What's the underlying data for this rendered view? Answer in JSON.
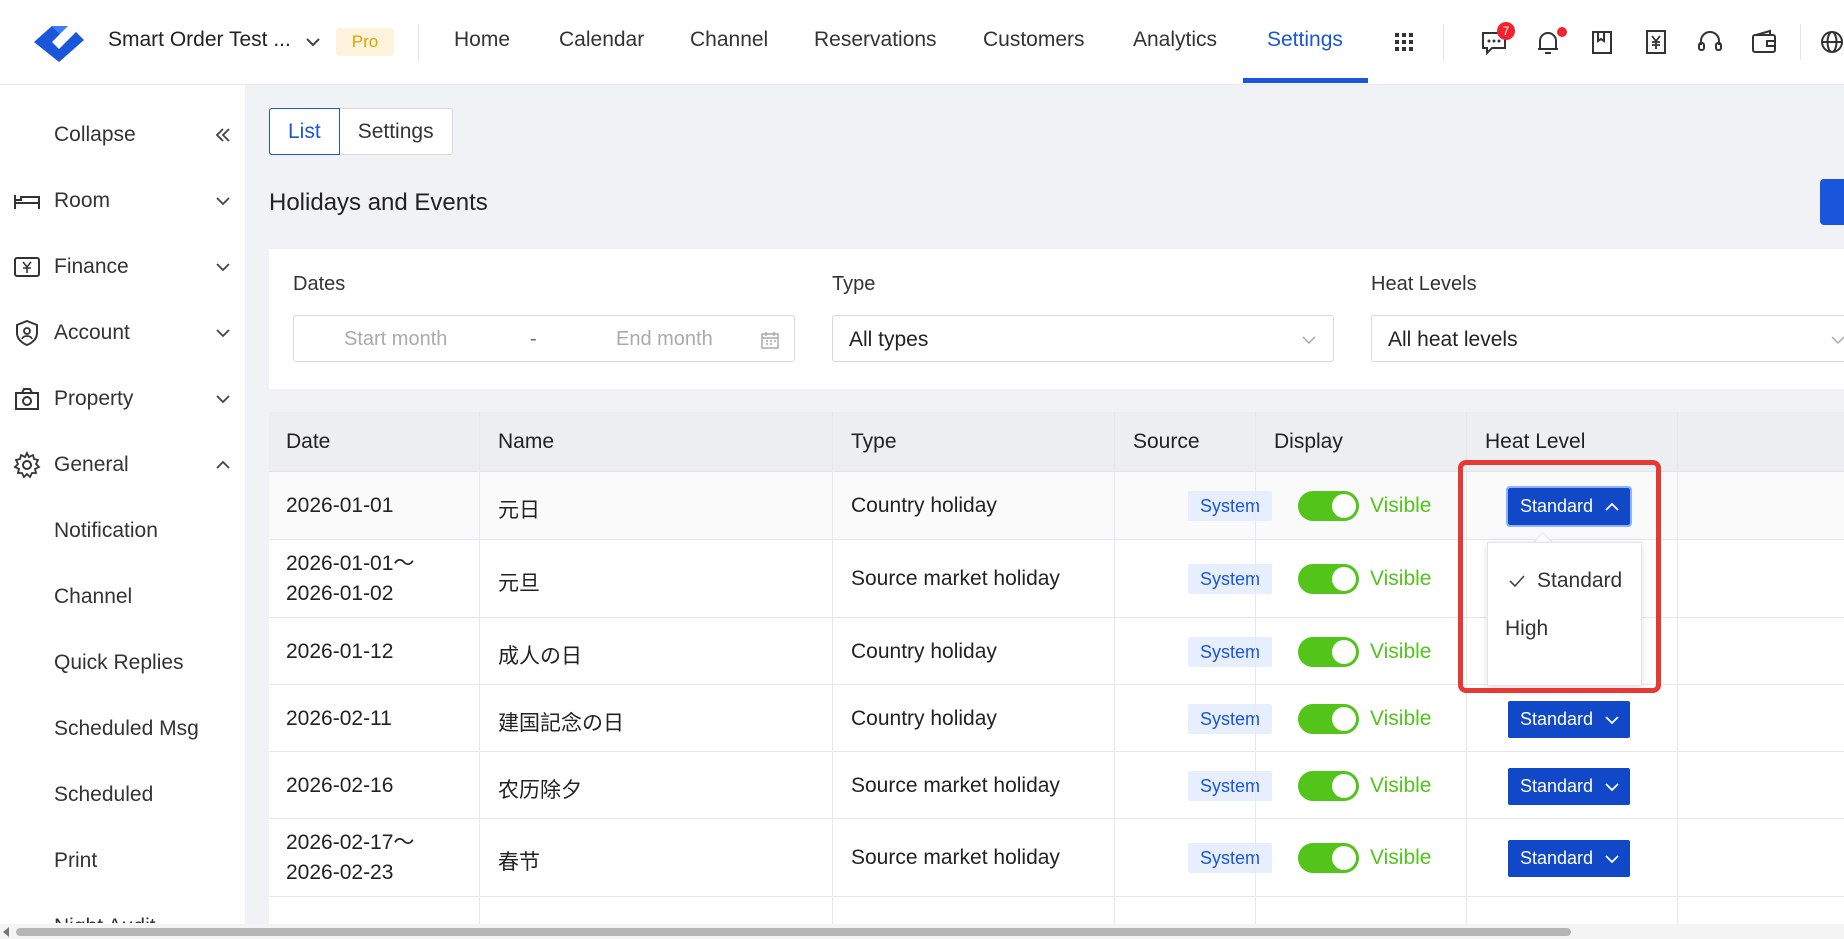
{
  "header": {
    "brand": "Smart Order Test ...",
    "plan_badge": "Pro",
    "nav": [
      "Home",
      "Calendar",
      "Channel",
      "Reservations",
      "Customers",
      "Analytics",
      "Settings"
    ],
    "active_nav": "Settings",
    "message_badge_count": "7",
    "icons": [
      "apps-grid-icon",
      "message-icon",
      "bell-icon",
      "bookmark-icon",
      "yen-receipt-icon",
      "headset-icon",
      "wallet-icon",
      "globe-icon"
    ]
  },
  "sidebar": {
    "collapse_label": "Collapse",
    "items": [
      {
        "label": "Room",
        "icon": "bed-icon",
        "expanded": false
      },
      {
        "label": "Finance",
        "icon": "finance-icon",
        "expanded": false
      },
      {
        "label": "Account",
        "icon": "shield-user-icon",
        "expanded": false
      },
      {
        "label": "Property",
        "icon": "property-icon",
        "expanded": false
      },
      {
        "label": "General",
        "icon": "gear-icon",
        "expanded": true
      }
    ],
    "sub_items": [
      "Notification",
      "Channel",
      "Quick Replies",
      "Scheduled Msg",
      "Scheduled",
      "Print",
      "Night Audit"
    ]
  },
  "tabs": {
    "list": "List",
    "settings": "Settings",
    "active": "List"
  },
  "page_title": "Holidays and Events",
  "filters": {
    "dates_label": "Dates",
    "start_placeholder": "Start month",
    "separator": "-",
    "end_placeholder": "End month",
    "type_label": "Type",
    "type_value": "All types",
    "heat_label": "Heat Levels",
    "heat_value": "All heat levels"
  },
  "table": {
    "columns": [
      "Date",
      "Name",
      "Type",
      "Source",
      "Display",
      "Heat Level"
    ],
    "rows": [
      {
        "date1": "2026-01-01",
        "date2": "",
        "name": "元日",
        "type": "Country holiday",
        "source": "System",
        "display": "Visible",
        "heat": "Standard"
      },
      {
        "date1": "2026-01-01～",
        "date2": "2026-01-02",
        "name": "元旦",
        "type": "Source market holiday",
        "source": "System",
        "display": "Visible",
        "heat": "Standard"
      },
      {
        "date1": "2026-01-12",
        "date2": "",
        "name": "成人の日",
        "type": "Country holiday",
        "source": "System",
        "display": "Visible",
        "heat": "Standard"
      },
      {
        "date1": "2026-02-11",
        "date2": "",
        "name": "建国記念の日",
        "type": "Country holiday",
        "source": "System",
        "display": "Visible",
        "heat": "Standard"
      },
      {
        "date1": "2026-02-16",
        "date2": "",
        "name": "农历除夕",
        "type": "Source market holiday",
        "source": "System",
        "display": "Visible",
        "heat": "Standard"
      },
      {
        "date1": "2026-02-17～",
        "date2": "2026-02-23",
        "name": "春节",
        "type": "Source market holiday",
        "source": "System",
        "display": "Visible",
        "heat": "Standard"
      }
    ]
  },
  "heat_dropdown": {
    "options": [
      "Standard",
      "High"
    ],
    "selected": "Standard"
  },
  "colors": {
    "accent": "#1a56db",
    "toggle_on": "#52c41a",
    "highlight": "#e53935"
  }
}
